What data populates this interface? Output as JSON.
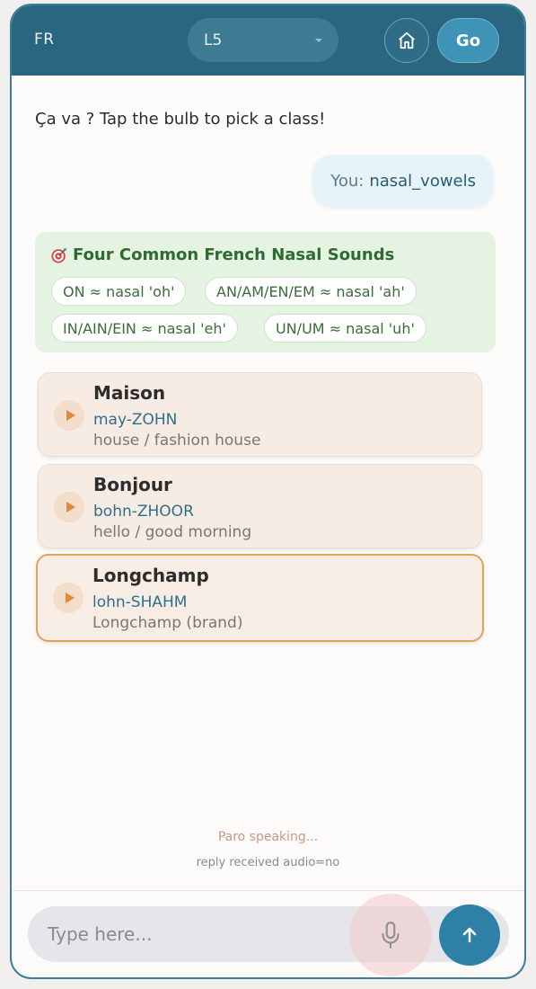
{
  "header": {
    "lang": "FR",
    "level": "L5",
    "home_icon": "home-icon",
    "go_label": "Go"
  },
  "chat": {
    "greeting": "Ça va ? Tap the bulb to pick a class!",
    "user_prefix": "You:",
    "user_value": "nasal_vowels"
  },
  "nasal_card": {
    "icon": "target-icon",
    "title": "Four Common French Nasal Sounds",
    "chips": [
      "ON ≈ nasal 'oh'",
      "AN/AM/EN/EM ≈ nasal 'ah'",
      "IN/AIN/EIN ≈ nasal 'eh'",
      "UN/UM ≈ nasal 'uh'"
    ]
  },
  "words": [
    {
      "word": "Maison",
      "pron": "may-ZOHN",
      "meaning": "house / fashion house",
      "selected": false
    },
    {
      "word": "Bonjour",
      "pron": "bohn-ZHOOR",
      "meaning": "hello / good morning",
      "selected": false
    },
    {
      "word": "Longchamp",
      "pron": "lohn-SHAHM",
      "meaning": "Longchamp (brand)",
      "selected": true
    }
  ],
  "status": {
    "speaking": "Paro speaking...",
    "debug": "reply received audio=no"
  },
  "composer": {
    "placeholder": "Type here...",
    "mic_icon": "microphone-icon",
    "send_icon": "arrow-up-icon"
  },
  "colors": {
    "header": "#2b6680",
    "accent": "#3e93b6",
    "nasal_card_bg": "#e5f3e2",
    "word_card_bg": "#f7ece3",
    "selected_border": "#e2a15d"
  }
}
